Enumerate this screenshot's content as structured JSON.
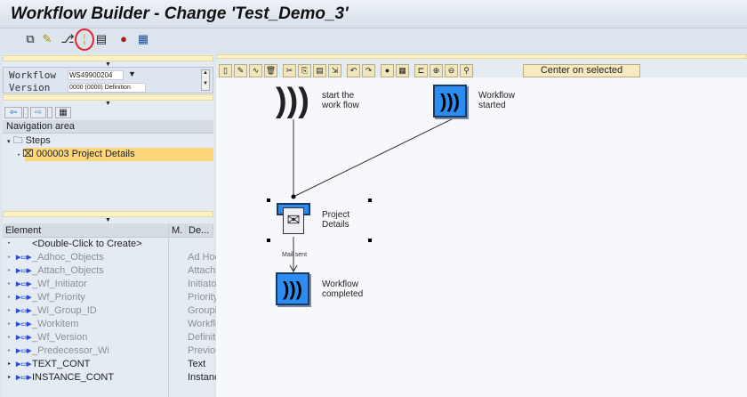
{
  "title": "Workflow Builder - Change 'Test_Demo_3'",
  "toolbar": {
    "icons": [
      "other-object-icon",
      "edit-icon",
      "workflow-wizard-icon",
      "wand-icon",
      "workflow-test-icon",
      "bindings-icon",
      "layout-icon"
    ],
    "highlighted": "wand-icon",
    "highlight_color": "#e0262a"
  },
  "form": {
    "workflow_label": "Workflow",
    "workflow_value": "WS49900204",
    "version_label": "Version",
    "version_value": "0000 (0000) Definition"
  },
  "navigation": {
    "header": "Navigation area",
    "steps_label": "Steps",
    "selected_item": "000003 Project Details"
  },
  "elements": {
    "columns": [
      "Element",
      "M.",
      "De..."
    ],
    "rows": [
      {
        "name": "<Double-Click to Create>",
        "desc": "",
        "active": true
      },
      {
        "name": "_Adhoc_Objects",
        "desc": "Ad Hoc",
        "active": false
      },
      {
        "name": "_Attach_Objects",
        "desc": "Attachm",
        "active": false
      },
      {
        "name": "_Wf_Initiator",
        "desc": "Initiator",
        "active": false
      },
      {
        "name": "_Wf_Priority",
        "desc": "Priority",
        "active": false
      },
      {
        "name": "_Wi_Group_ID",
        "desc": "Groupin",
        "active": false
      },
      {
        "name": "_Workitem",
        "desc": "Workflo",
        "active": false
      },
      {
        "name": "_Wf_Version",
        "desc": "Definiti",
        "active": false
      },
      {
        "name": "_Predecessor_Wi",
        "desc": "Previou",
        "active": false
      },
      {
        "name": "TEXT_CONT",
        "desc": "Text",
        "active": true
      },
      {
        "name": "INSTANCE_CONT",
        "desc": "Instanc",
        "active": true
      }
    ]
  },
  "canvas": {
    "center_button": "Center on selected objects",
    "nodes": {
      "start": "start the work flow",
      "started": "Workflow started",
      "project": "Project Details",
      "completed": "Workflow completed"
    },
    "edge_label": "Mail sent",
    "node_color": "#2d8cf0"
  }
}
